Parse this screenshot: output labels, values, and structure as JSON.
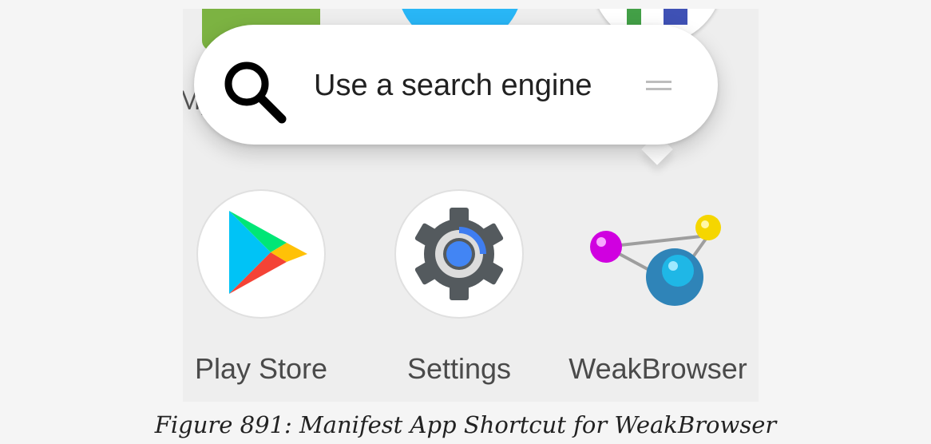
{
  "launcher": {
    "shortcut_popup": {
      "label": "Use a search engine",
      "icon": "search-icon",
      "handle_icon": "drag-handle-icon"
    },
    "apps": [
      {
        "label": "Play Store",
        "icon": "play-store-icon"
      },
      {
        "label": "Settings",
        "icon": "settings-gear-icon"
      },
      {
        "label": "WeakBrowser",
        "icon": "weakbrowser-molecule-icon"
      }
    ],
    "partial_label": "My"
  },
  "caption": "Figure 891: Manifest App Shortcut for WeakBrowser"
}
